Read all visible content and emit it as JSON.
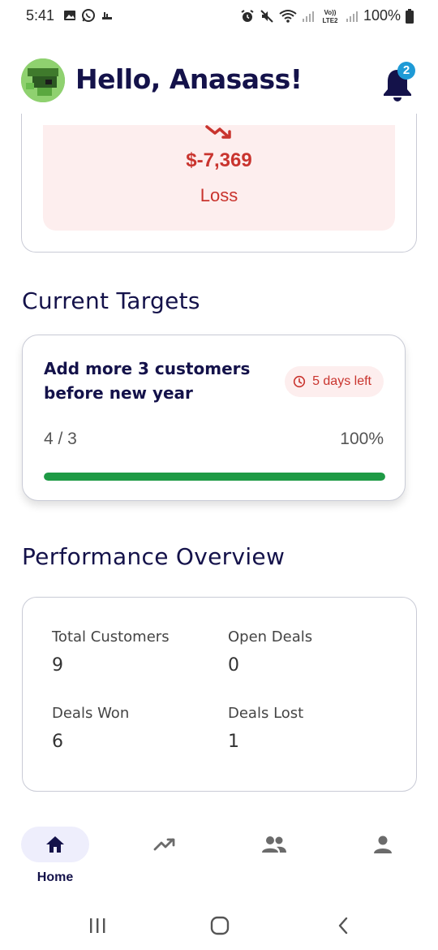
{
  "status_bar": {
    "time": "5:41",
    "battery": "100%",
    "left_icons": [
      "gallery-icon",
      "whatsapp-icon",
      "notification-icon"
    ],
    "right_icons": [
      "alarm-icon",
      "mute-icon",
      "wifi-icon",
      "signal-icon",
      "volte-icon",
      "signal-icon",
      "battery-icon"
    ]
  },
  "header": {
    "greeting": "Hello, Anasass!",
    "notification_count": "2"
  },
  "summary": {
    "amount": "$-7,369",
    "status": "Loss",
    "accent_color": "#c9342e",
    "box_color": "#fdeeee"
  },
  "targets": {
    "section_title": "Current Targets",
    "items": [
      {
        "title": "Add more 3 customers before new year",
        "deadline": "5 days left",
        "progress_text": "4 / 3",
        "percent_text": "100%",
        "progress_fraction": 1.0,
        "bar_color": "#1e9a45"
      }
    ]
  },
  "performance": {
    "section_title": "Performance Overview",
    "stats": [
      {
        "label": "Total Customers",
        "value": "9"
      },
      {
        "label": "Open Deals",
        "value": "0"
      },
      {
        "label": "Deals Won",
        "value": "6"
      },
      {
        "label": "Deals Lost",
        "value": "1"
      }
    ]
  },
  "bottom_nav": {
    "items": [
      {
        "icon": "home-icon",
        "label": "Home",
        "active": true
      },
      {
        "icon": "trending-up-icon",
        "label": "",
        "active": false
      },
      {
        "icon": "group-icon",
        "label": "",
        "active": false
      },
      {
        "icon": "person-icon",
        "label": "",
        "active": false
      }
    ]
  },
  "system_nav": [
    "recents-icon",
    "home-circle-icon",
    "back-icon"
  ]
}
